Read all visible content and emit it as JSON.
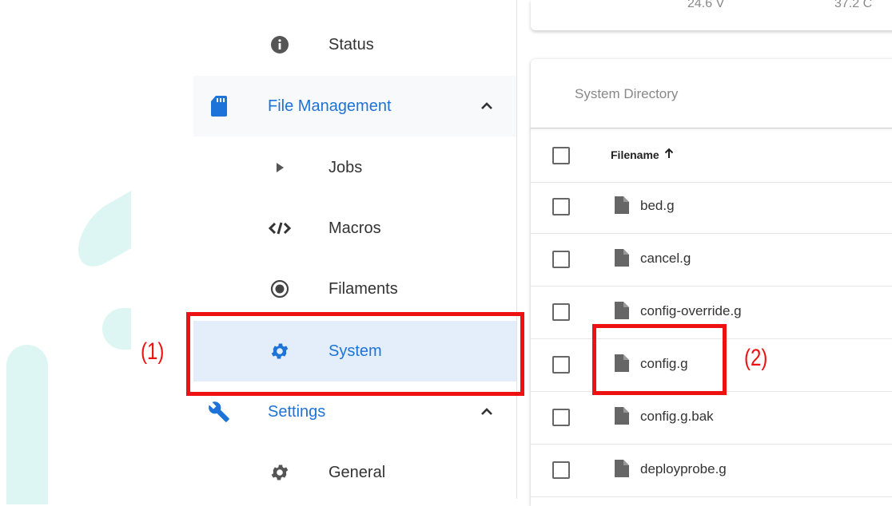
{
  "sidebar": {
    "items": [
      {
        "label": "Status",
        "icon": "info-icon"
      },
      {
        "label": "File Management",
        "icon": "sd-card-icon",
        "expanded": true
      },
      {
        "label": "Jobs",
        "icon": "play-icon"
      },
      {
        "label": "Macros",
        "icon": "code-icon"
      },
      {
        "label": "Filaments",
        "icon": "radio-icon"
      },
      {
        "label": "System",
        "icon": "gear-icon",
        "active": true
      },
      {
        "label": "Settings",
        "icon": "wrench-icon",
        "expanded": true
      },
      {
        "label": "General",
        "icon": "gear-icon"
      }
    ]
  },
  "top_panel": {
    "values": [
      "24.6 V",
      "37.2 C"
    ]
  },
  "file_panel": {
    "title": "System Directory",
    "column_header": "Filename",
    "files": [
      "bed.g",
      "cancel.g",
      "config-override.g",
      "config.g",
      "config.g.bak",
      "deployprobe.g"
    ]
  },
  "annotations": {
    "label1": "(1)",
    "label2": "(2)"
  },
  "colors": {
    "accent": "#1e73d8",
    "annotation": "#ee1111",
    "active_bg": "#e3eefa"
  }
}
